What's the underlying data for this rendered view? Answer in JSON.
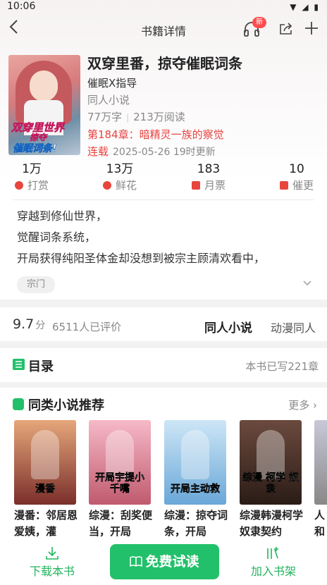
{
  "status_bar": {
    "time": "10:06",
    "icons": [
      "wifi-icon",
      "signal-icon",
      "battery-icon"
    ]
  },
  "nav": {
    "title": "书籍详情",
    "badge": "新"
  },
  "book": {
    "title": "双穿里番，掠夺催眠词条",
    "author": "催眠X指导",
    "genre": "同人小说",
    "words": "77万字",
    "reads": "213万阅读",
    "latest_chapter": "第184章：暗精灵一族的察觉",
    "serial_status": "连载",
    "update_time": "2025-05-26 19时更新",
    "cover_lines": [
      "双穿里世界",
      "掠夺",
      "催眠词条!"
    ]
  },
  "metrics": [
    {
      "value": "1万",
      "label": "打赏"
    },
    {
      "value": "13万",
      "label": "鲜花"
    },
    {
      "value": "183",
      "label": "月票"
    },
    {
      "value": "10",
      "label": "催更"
    }
  ],
  "synopsis": [
    "穿越到修仙世界，",
    "觉醒词条系统，",
    "开局获得纯阳圣体金却没想到被宗主顾清欢看中，"
  ],
  "tag": "宗门",
  "rating": {
    "score": "9.7",
    "unit": "分",
    "count": "6511人已评价",
    "category1": "同人小说",
    "category2": "动漫同人"
  },
  "toc": {
    "label": "目录",
    "written": "本书已写221章"
  },
  "recommend": {
    "label": "同类小说推荐",
    "more": "更多",
    "books": [
      {
        "title": "漫番：邻居恩爱姨，灌",
        "cover_text": "漫香",
        "color1": "#e6a77a",
        "color2": "#7a2f2a"
      },
      {
        "title": "综漫：刮奖便当，开局",
        "cover_text": "开局宇提小千嘴",
        "color1": "#f6b9c8",
        "color2": "#c05a6e"
      },
      {
        "title": "综漫：掠夺词条，开局",
        "cover_text": "开局主动救",
        "color1": "#cde6f6",
        "color2": "#6aa7d8"
      },
      {
        "title": "综漫韩漫柯学奴隶契约",
        "cover_text": "综漫 柯学 奴隶",
        "color1": "#6b4a3e",
        "color2": "#2a1c16"
      },
      {
        "title": "人和",
        "cover_text": "",
        "color1": "#c8c8d8",
        "color2": "#888"
      }
    ]
  },
  "bottom": {
    "download": "下载本书",
    "read": "免费试读",
    "shelf": "加入书架"
  },
  "colors": {
    "accent_green": "#22c06a",
    "accent_red": "#e64340"
  }
}
